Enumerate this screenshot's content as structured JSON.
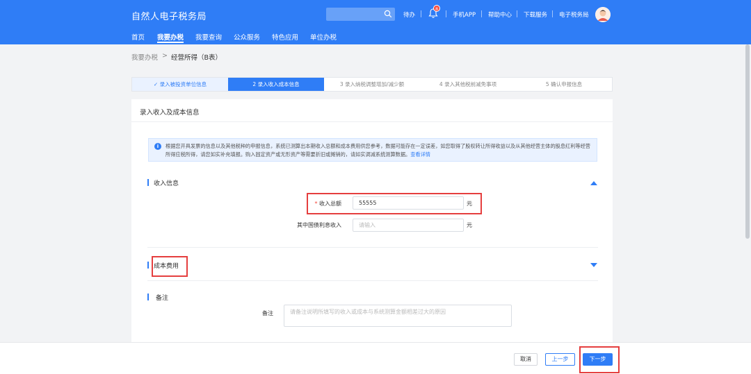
{
  "header": {
    "logo": "自然人电子税务局",
    "search_placeholder": "",
    "todo": "待办",
    "notification_count": "8",
    "links": [
      "手机APP",
      "帮助中心",
      "下载服务",
      "电子税务局"
    ]
  },
  "nav": [
    "首页",
    "我要办税",
    "我要查询",
    "公众服务",
    "特色应用",
    "单位办税"
  ],
  "breadcrumb": {
    "parent": "我要办税",
    "separator": ">",
    "current": "经营所得（B表）"
  },
  "steps": [
    {
      "label": "✓ 录入被投资单位信息",
      "state": "done"
    },
    {
      "label": "2  录入收入成本信息",
      "state": "active"
    },
    {
      "label": "3  录入纳税调整增加/减少额",
      "state": "todo"
    },
    {
      "label": "4  录入其他税前减免事项",
      "state": "todo"
    },
    {
      "label": "5  确认申报信息",
      "state": "todo"
    }
  ],
  "card": {
    "title": "录入收入及成本信息",
    "notice": "根据您开具发票的信息以及其他税种的申报信息，系统已测算出本期收入总额和成本费用供您参考，数据可能存在一定误差，如您取得了股权转让所得收益以及从其他经营主体的股息红利等经营所得应税所得，请您如实补充填报。购入固定资产或无形资产等需要折旧或摊销的，请如实调减系统测算数据。",
    "notice_link": "查看详情",
    "income_section": "收入信息",
    "total_income_label": "收入总额",
    "total_income_value": "55555",
    "bond_interest_label": "其中国债利息收入",
    "bond_interest_placeholder": "请输入",
    "unit": "元",
    "cost_section": "成本费用",
    "remark_section": "备注",
    "remark_label": "备注",
    "remark_placeholder": "请备注说明所填写的收入或成本与系统测算金额相差过大的原因"
  },
  "footer": {
    "cancel": "取消",
    "prev": "上一步",
    "next": "下一步"
  },
  "colors": {
    "primary": "#2f7df6",
    "highlight": "#e53e3e"
  }
}
